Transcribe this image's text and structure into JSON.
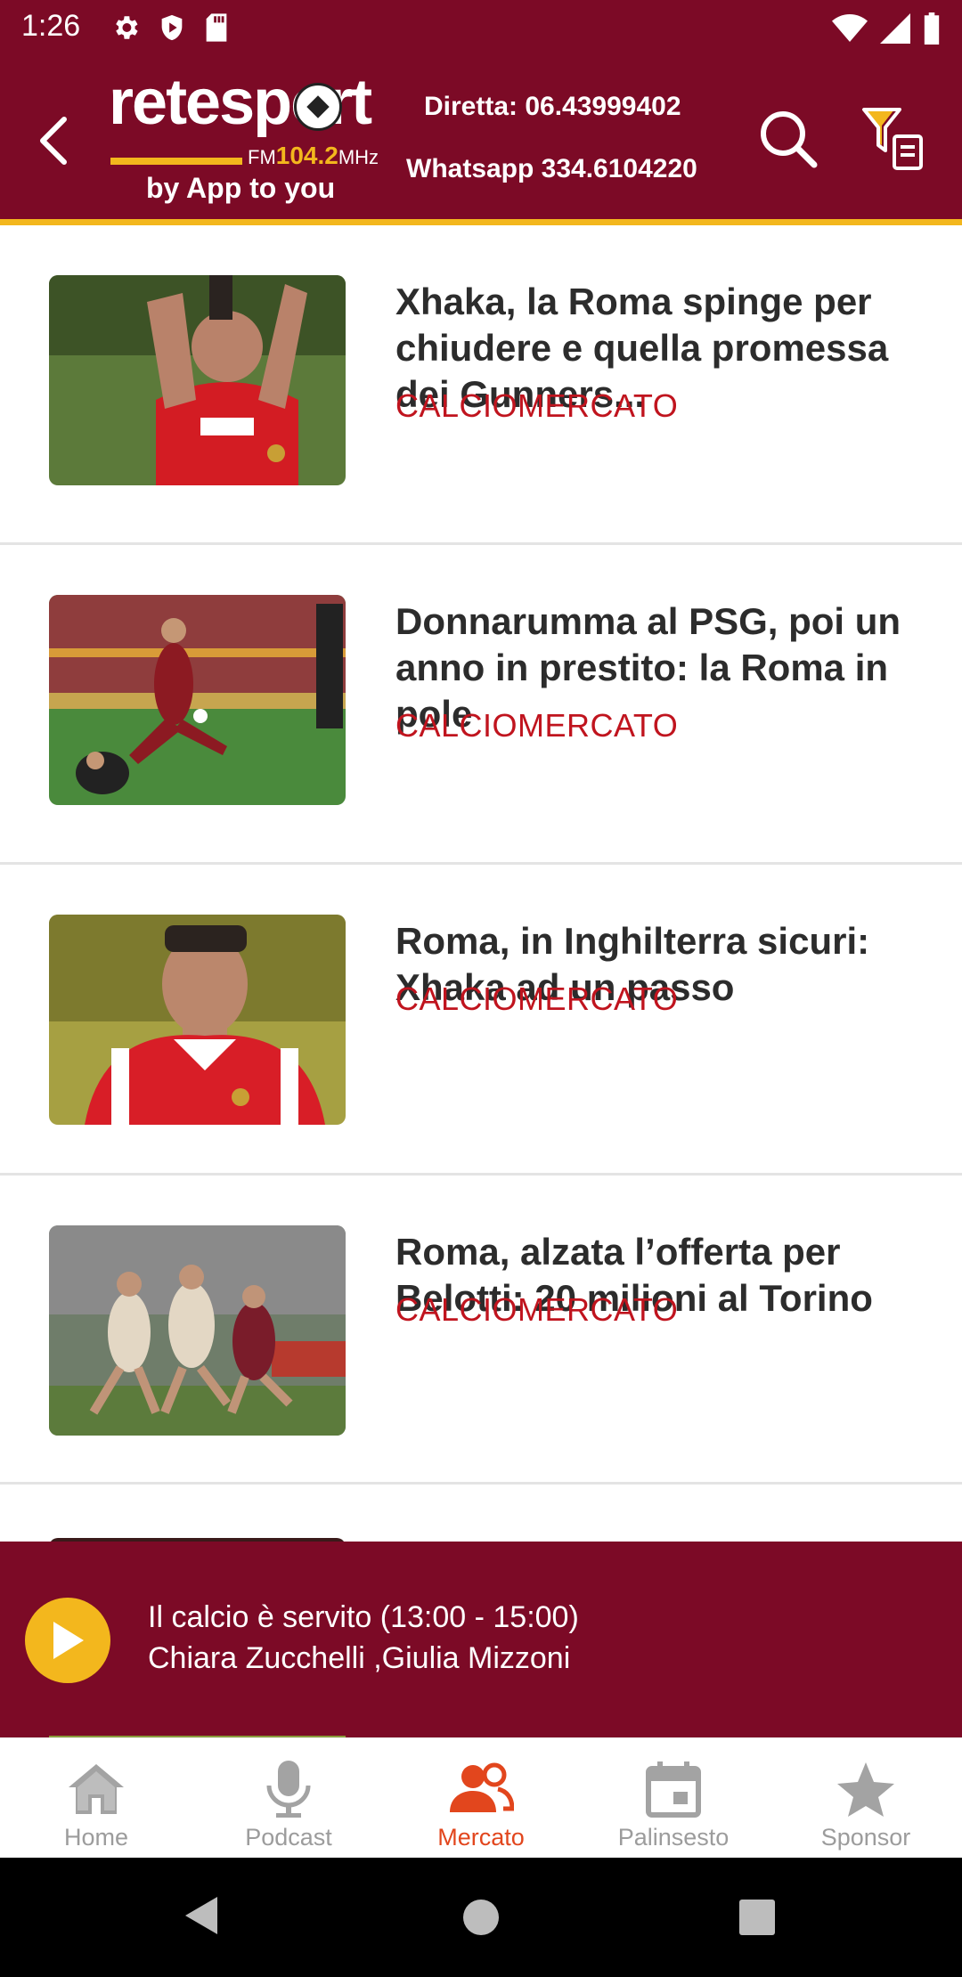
{
  "status_bar": {
    "time": "1:26",
    "left_icons": [
      "gear-icon",
      "shield-play-icon",
      "sd-card-icon"
    ],
    "right_icons": [
      "wifi-icon",
      "signal-icon",
      "battery-icon"
    ]
  },
  "header": {
    "logo_text": "retesport",
    "logo_freq_prefix": "FM",
    "logo_freq": "104.2",
    "logo_freq_unit": "MHz",
    "tagline": "by App to you",
    "phone": "Diretta: 06.43999402",
    "whatsapp": "Whatsapp 334.6104220",
    "colors": {
      "brand": "#7c0a26",
      "accent": "#f3b71d"
    }
  },
  "articles": [
    {
      "title": "Xhaka, la Roma spinge per chiudere e quella promessa dei Gunners...",
      "category": "CALCIOMERCATO"
    },
    {
      "title": "Donnarumma al PSG, poi un anno in prestito: la Roma in pole",
      "category": "CALCIOMERCATO"
    },
    {
      "title": "Roma, in Inghilterra sicuri: Xhaka ad un passo",
      "category": "CALCIOMERCATO"
    },
    {
      "title": "Roma, alzata l’offerta per Belotti: 20 milioni al Torino",
      "category": "CALCIOMERCATO"
    }
  ],
  "player": {
    "show_title": "Il calcio è servito (13:00 - 15:00)",
    "hosts": "Chiara Zucchelli ,Giulia Mizzoni"
  },
  "bottom_nav": {
    "items": [
      {
        "label": "Home",
        "icon": "home-icon"
      },
      {
        "label": "Podcast",
        "icon": "microphone-icon"
      },
      {
        "label": "Mercato",
        "icon": "people-icon",
        "active": true
      },
      {
        "label": "Palinsesto",
        "icon": "calendar-icon"
      },
      {
        "label": "Sponsor",
        "icon": "star-icon"
      }
    ],
    "active_color": "#e2461d"
  }
}
